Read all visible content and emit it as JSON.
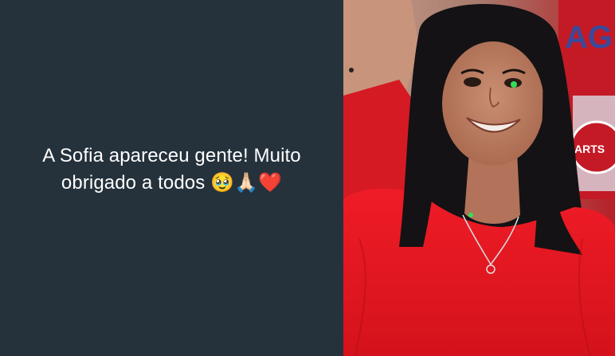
{
  "post": {
    "text_line1": "A Sofia apareceu gente! Muito",
    "text_line2": "obrigado a todos",
    "emojis": "🥹🙏🏻❤️"
  },
  "photo": {
    "background_sign_text_1": "AG",
    "background_sign_text_2": "ARTS"
  },
  "colors": {
    "panel_bg": "#25323c",
    "text": "#ffffff",
    "shirt_red": "#e3151f"
  }
}
